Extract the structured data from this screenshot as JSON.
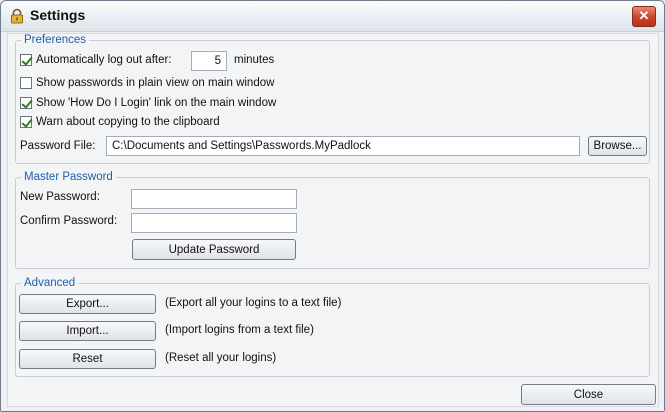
{
  "window": {
    "title": "Settings",
    "title_icon": "padlock-icon",
    "close_icon": "close-icon"
  },
  "preferences": {
    "legend": "Preferences",
    "auto_logout": {
      "checked": true,
      "label": "Automatically log out after:",
      "value": "5",
      "unit": "minutes"
    },
    "show_plain": {
      "checked": false,
      "label": "Show passwords in plain view on main window"
    },
    "show_howto": {
      "checked": true,
      "label": "Show 'How Do I Login' link on the main window"
    },
    "warn_copy": {
      "checked": true,
      "label": "Warn about copying to the clipboard"
    },
    "password_file": {
      "label": "Password File:",
      "value": "C:\\Documents and Settings\\Passwords.MyPadlock",
      "browse_label": "Browse..."
    }
  },
  "master": {
    "legend": "Master Password",
    "new_label": "New Password:",
    "new_value": "",
    "confirm_label": "Confirm Password:",
    "confirm_value": "",
    "update_label": "Update Password"
  },
  "advanced": {
    "legend": "Advanced",
    "actions": [
      {
        "button": "Export...",
        "desc": "(Export all your logins to a text file)"
      },
      {
        "button": "Import...",
        "desc": "(Import logins from a text file)"
      },
      {
        "button": "Reset",
        "desc": "(Reset all your logins)"
      }
    ]
  },
  "footer": {
    "close_label": "Close"
  }
}
